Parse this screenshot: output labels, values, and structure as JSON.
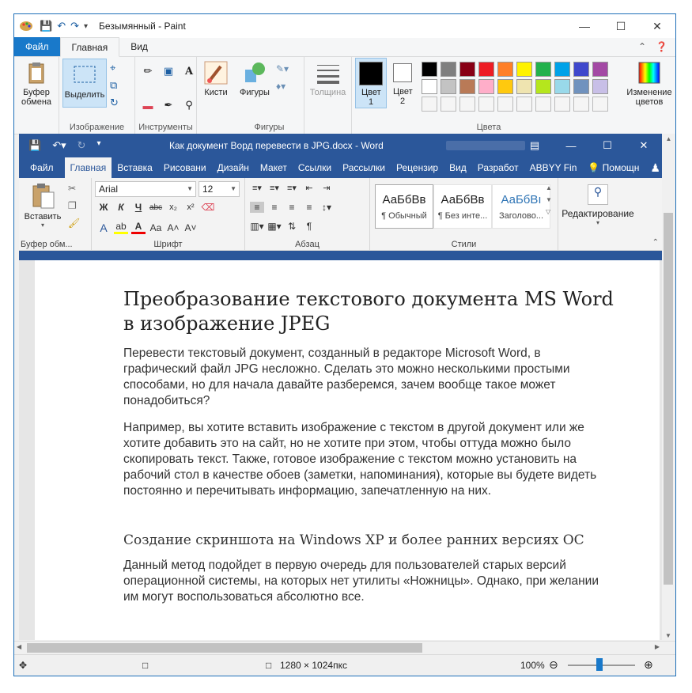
{
  "paint": {
    "title": "Безымянный - Paint",
    "tabs": {
      "file": "Файл",
      "home": "Главная",
      "view": "Вид"
    },
    "clipboard_label": "Буфер обмена",
    "select_label": "Выделить",
    "groups": {
      "image": "Изображение",
      "tools": "Инструменты",
      "shapes": "Фигуры",
      "colors": "Цвета"
    },
    "brushes_label": "Кисти",
    "shapes_label": "Фигуры",
    "thickness_label": "Толщина",
    "color1_label": "Цвет 1",
    "color2_label": "Цвет 2",
    "edit_colors_label": "Изменение цветов",
    "palette": [
      "#000000",
      "#7f7f7f",
      "#880015",
      "#ed1c24",
      "#ff7f27",
      "#fff200",
      "#22b14c",
      "#00a2e8",
      "#3f48cc",
      "#a349a4",
      "#ffffff",
      "#c3c3c3",
      "#b97a57",
      "#ffaec9",
      "#ffc90e",
      "#efe4b0",
      "#b5e61d",
      "#99d9ea",
      "#7092be",
      "#c8bfe7",
      "#f5f5f5",
      "#f5f5f5",
      "#f5f5f5",
      "#f5f5f5",
      "#f5f5f5",
      "#f5f5f5",
      "#f5f5f5",
      "#f5f5f5",
      "#f5f5f5",
      "#f5f5f5"
    ],
    "status": {
      "dimensions": "1280 × 1024пкс",
      "zoom": "100%"
    }
  },
  "word": {
    "title": "Как документ Ворд перевести в JPG.docx  -  Word",
    "tabs": [
      "Файл",
      "Главная",
      "Вставка",
      "Рисовани",
      "Дизайн",
      "Макет",
      "Ссылки",
      "Рассылки",
      "Рецензир",
      "Вид",
      "Разработ",
      "ABBYY Fin",
      "Помощн"
    ],
    "font_name": "Arial",
    "font_size": "12",
    "paste_label": "Вставить",
    "groups": {
      "clipboard": "Буфер обм...",
      "font": "Шрифт",
      "paragraph": "Абзац",
      "styles": "Стили"
    },
    "styles": [
      {
        "sample": "АаБбВв",
        "name": "¶ Обычный"
      },
      {
        "sample": "АаБбВв",
        "name": "¶ Без инте..."
      },
      {
        "sample": "АаБбВı",
        "name": "Заголово..."
      }
    ],
    "editing_label": "Редактирование",
    "document": {
      "heading": "Преобразование текстового документа MS Word в изображение JPEG",
      "p1": "Перевести текстовый документ, созданный в редакторе Microsoft Word, в графический файл JPG несложно. Сделать это можно несколькими простыми способами, но для начала давайте разберемся, зачем вообще такое может понадобиться?",
      "p2": "Например, вы хотите вставить изображение с текстом в другой документ или же хотите добавить это на сайт, но не хотите при этом, чтобы оттуда можно было скопировать текст. Также, готовое изображение с текстом можно установить на рабочий стол в качестве обоев (заметки, напоминания), которые вы будете видеть постоянно и перечитывать информацию, запечатленную на них.",
      "subheading": "Создание скриншота на Windows XP и более ранних версиях ОС",
      "p3": "Данный метод подойдет в первую очередь для пользователей старых версий операционной системы, на которых нет утилиты «Ножницы». Однако, при желании им могут воспользоваться абсолютно все."
    }
  }
}
